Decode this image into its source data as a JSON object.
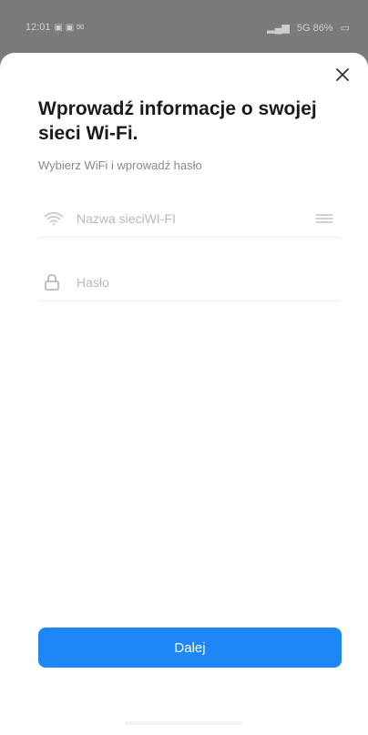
{
  "status_bar": {
    "left_text": "12:01",
    "right_text": "5G 86%"
  },
  "form": {
    "title": "Wprowadź informacje o swojej sieci Wi-Fi.",
    "subtitle": "Wybierz WiFi i wprowadź hasło",
    "wifi_placeholder": "Nazwa sieciWI-FI",
    "wifi_value": "",
    "password_placeholder": "Hasło",
    "password_value": "",
    "next_label": "Dalej"
  },
  "icons": {
    "close": "close-icon",
    "wifi": "wifi-icon",
    "network_list": "network-list-icon",
    "lock": "lock-icon"
  },
  "colors": {
    "primary": "#1d87f5",
    "title": "#1a1a1a",
    "subtitle": "#888888",
    "placeholder": "#b8b8b8",
    "backdrop": "#7d7d7d"
  }
}
